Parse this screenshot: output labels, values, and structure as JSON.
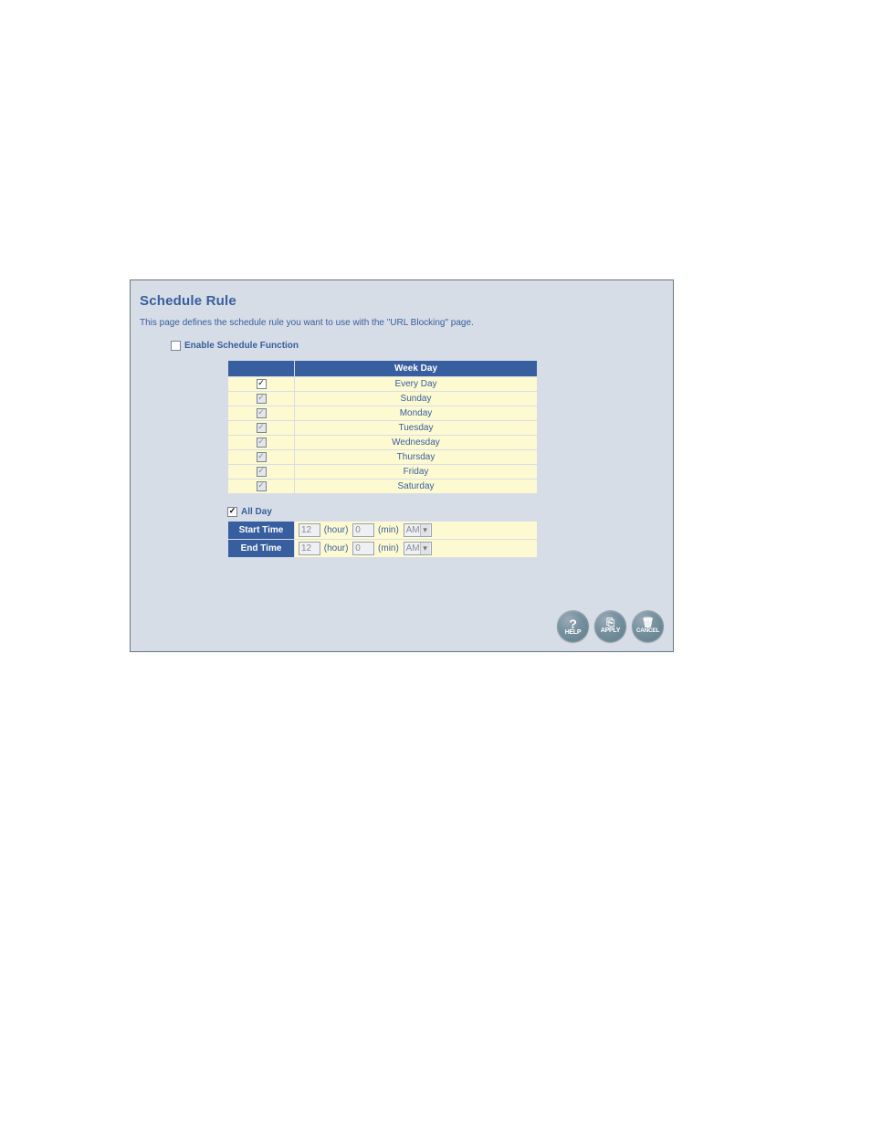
{
  "title": "Schedule Rule",
  "description": "This page defines the schedule rule you want to use with the \"URL Blocking\" page.",
  "enable_label": "Enable Schedule Function",
  "enable_checked": false,
  "table_header_blank": "",
  "table_header_weekday": "Week Day",
  "days": [
    {
      "label": "Every Day",
      "checked": true,
      "disabled": false
    },
    {
      "label": "Sunday",
      "checked": true,
      "disabled": true
    },
    {
      "label": "Monday",
      "checked": true,
      "disabled": true
    },
    {
      "label": "Tuesday",
      "checked": true,
      "disabled": true
    },
    {
      "label": "Wednesday",
      "checked": true,
      "disabled": true
    },
    {
      "label": "Thursday",
      "checked": true,
      "disabled": true
    },
    {
      "label": "Friday",
      "checked": true,
      "disabled": true
    },
    {
      "label": "Saturday",
      "checked": true,
      "disabled": true
    }
  ],
  "all_day_label": "All Day",
  "all_day_checked": true,
  "time_rows": [
    {
      "label": "Start Time",
      "hour": "12",
      "min": "0",
      "ampm": "AM"
    },
    {
      "label": "End Time",
      "hour": "12",
      "min": "0",
      "ampm": "AM"
    }
  ],
  "hour_unit": "(hour)",
  "min_unit": "(min)",
  "buttons": {
    "help": "HELP",
    "apply": "APPLY",
    "cancel": "CANCEL"
  }
}
